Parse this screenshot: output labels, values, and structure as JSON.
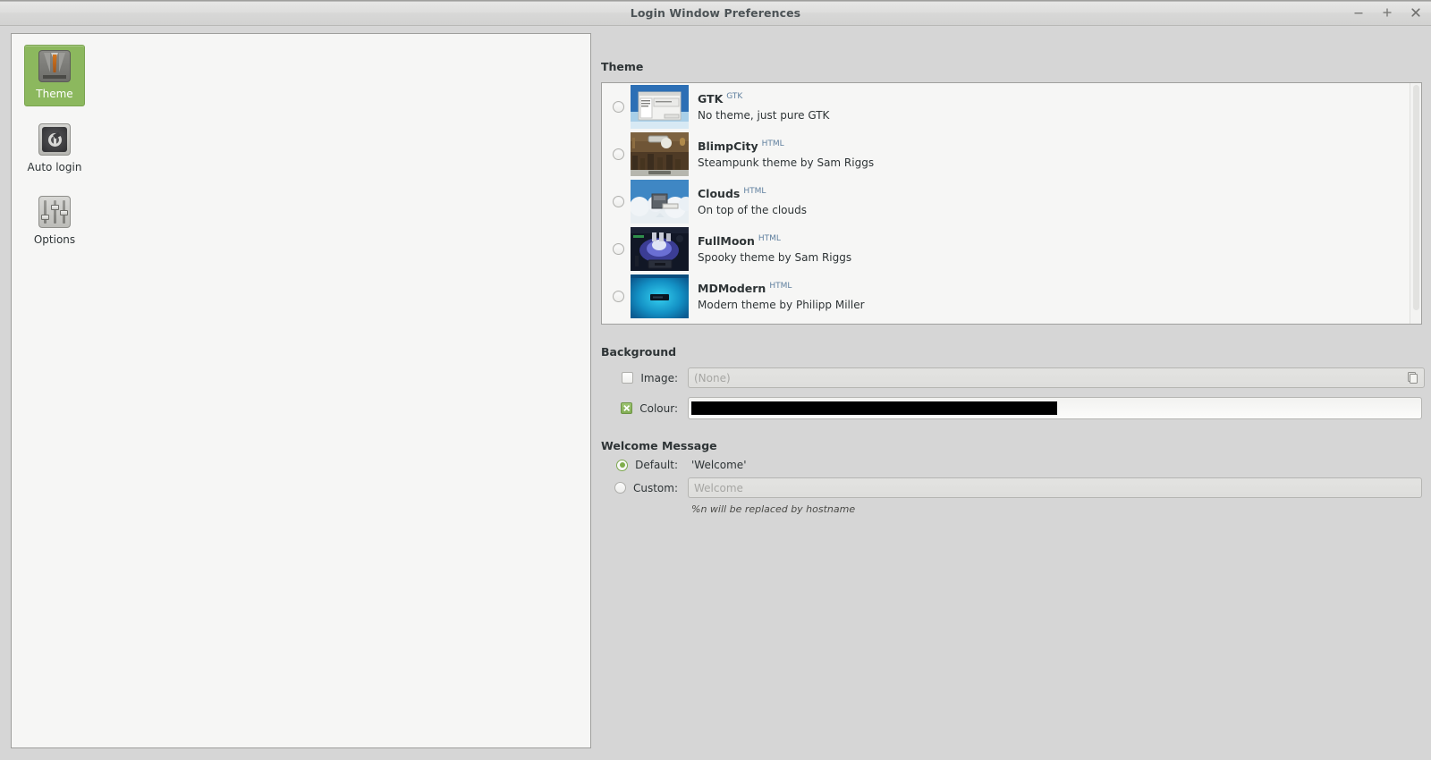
{
  "window": {
    "title": "Login Window Preferences",
    "controls": [
      {
        "name": "minimize",
        "glyph": "–"
      },
      {
        "name": "maximize",
        "glyph": "+"
      },
      {
        "name": "close",
        "glyph": "×"
      }
    ]
  },
  "sidebar": {
    "items": [
      {
        "label": "Theme",
        "icon": "suit-icon",
        "selected": true
      },
      {
        "label": "Auto login",
        "icon": "power-icon",
        "selected": false
      },
      {
        "label": "Options",
        "icon": "sliders-icon",
        "selected": false
      }
    ]
  },
  "theme_section": {
    "title": "Theme",
    "toolbar": [
      {
        "name": "add-theme",
        "icon": "plus-icon",
        "enabled": true
      },
      {
        "name": "remove-theme",
        "icon": "close-icon",
        "enabled": false
      },
      {
        "name": "theme-settings",
        "icon": "gear-icon",
        "enabled": true
      }
    ],
    "items": [
      {
        "name": "GTK",
        "kind": "GTK",
        "description": "No theme, just pure GTK",
        "selected": false
      },
      {
        "name": "BlimpCity",
        "kind": "HTML",
        "description": "Steampunk theme by Sam Riggs",
        "selected": false
      },
      {
        "name": "Clouds",
        "kind": "HTML",
        "description": "On top of the clouds",
        "selected": false
      },
      {
        "name": "FullMoon",
        "kind": "HTML",
        "description": "Spooky theme by Sam Riggs",
        "selected": false
      },
      {
        "name": "MDModern",
        "kind": "HTML",
        "description": "Modern theme by Philipp Miller",
        "selected": false
      }
    ]
  },
  "background_section": {
    "title": "Background",
    "image": {
      "label": "Image:",
      "checked": false,
      "value": "(None)",
      "file_button": "file-chooser-icon"
    },
    "colour": {
      "label": "Colour:",
      "checked": true,
      "value": "#000000"
    }
  },
  "welcome_section": {
    "title": "Welcome Message",
    "default": {
      "label": "Default:",
      "value": "'Welcome'",
      "selected": true
    },
    "custom": {
      "label": "Custom:",
      "placeholder": "Welcome",
      "value": "",
      "selected": false
    },
    "hint": "%n will be replaced by hostname"
  },
  "colors": {
    "accent_green": "#8cb85e",
    "titlebar": "#dededd",
    "window_bg": "#d6d6d6",
    "panel_bg": "#f6f6f5",
    "text": "#2e3436",
    "kind_label": "#5f7f9e"
  }
}
